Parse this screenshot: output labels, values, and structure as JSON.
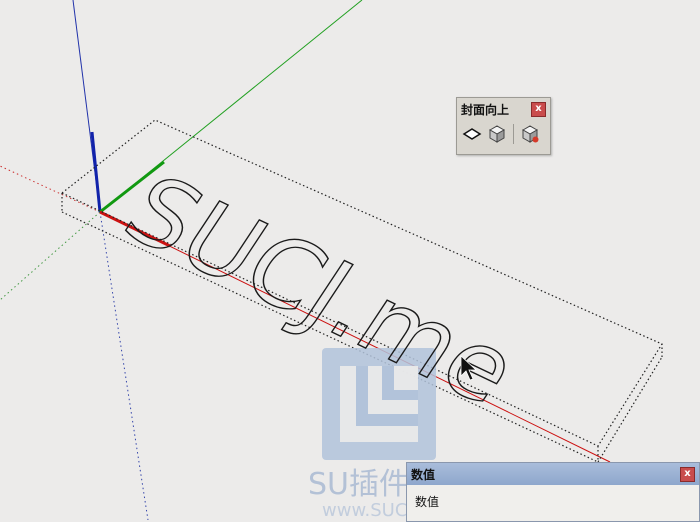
{
  "scene": {
    "model_text": "SUCJ.me",
    "watermark": {
      "brand": "SU插件库",
      "site": "www.SUCJ.me"
    },
    "colors": {
      "background": "#ecebea",
      "axis_red": "#cc1111",
      "axis_green": "#119911",
      "axis_blue": "#1122aa"
    }
  },
  "toolbar": {
    "title": "封面向上",
    "close_label": "x",
    "tools": [
      {
        "icon": "face-plane-icon"
      },
      {
        "icon": "box-icon"
      },
      {
        "icon": "box-orient-icon"
      }
    ]
  },
  "vcb": {
    "title": "数值",
    "close_label": "x",
    "label": "数值"
  }
}
